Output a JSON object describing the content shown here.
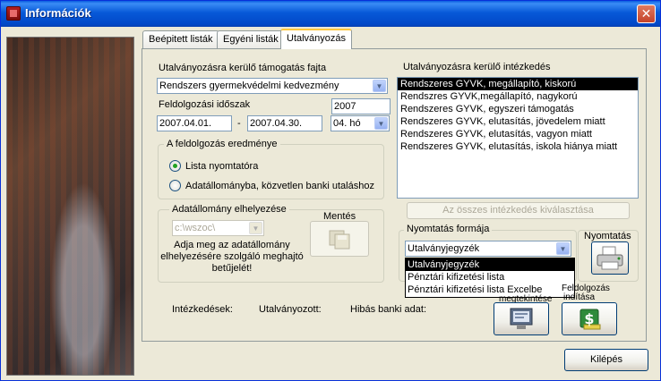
{
  "window": {
    "title": "Információk",
    "close": "✕"
  },
  "tabs": [
    {
      "label": "Beépitett listák"
    },
    {
      "label": "Egyéni listák"
    },
    {
      "label": "Utalványozás"
    }
  ],
  "left": {
    "support_type_label": "Utalványozásra kerülő támogatás fajta",
    "support_type_value": "Rendszers gyermekvédelmi kedvezmény",
    "period_label": "Feldolgozási időszak",
    "year": "2007",
    "date_from": "2007.04.01.",
    "dash": "-",
    "date_to": "2007.04.30.",
    "month": "04. hó",
    "result_group_title": "A feldolgozás eredménye",
    "radio_print": "Lista nyomtatóra",
    "radio_file": "Adatállományba, közvetlen banki utaláshoz",
    "file_group_title": "Adatállomány elhelyezése",
    "file_path": "c:\\wszoc\\",
    "file_hint": "Adja meg az adatállomány elhelyezésére szolgáló meghajtó betűjelét!",
    "save_label": "Mentés"
  },
  "right": {
    "measures_label": "Utalványozásra kerülő intézkedés",
    "measures": [
      "Rendszeres GYVK, megállapító, kiskorú",
      "Rendszres GYVK,megállapító, nagykorú",
      "Rendszeres GYVK, egyszeri támogatás",
      "Rendszeres GYVK, elutasítás, jövedelem miatt",
      "Rendszeres GYVK, elutasítás, vagyon miatt",
      "Rendszeres GYVK, elutasítás, iskola hiánya miatt"
    ],
    "select_all_label": "Az összes intézkedés kiválasztása",
    "print_form_title": "Nyomtatás formája",
    "print_form_value": "Utalványjegyzék",
    "print_form_options": [
      "Utalványjegyzék",
      "Pénztári kifizetési lista",
      "Pénztári kifizetési lista Excelbe"
    ],
    "print_label": "Nyomtatás",
    "display_label": "megtekintése",
    "processing_label_1": "Feldolgozás",
    "processing_label_2": "indítása"
  },
  "bottom": {
    "measures_count_label": "Intézkedések:",
    "vouchered_label": "Utalványozott:",
    "bank_error_label": "Hibás banki adat:",
    "exit_label": "Kilépés"
  }
}
